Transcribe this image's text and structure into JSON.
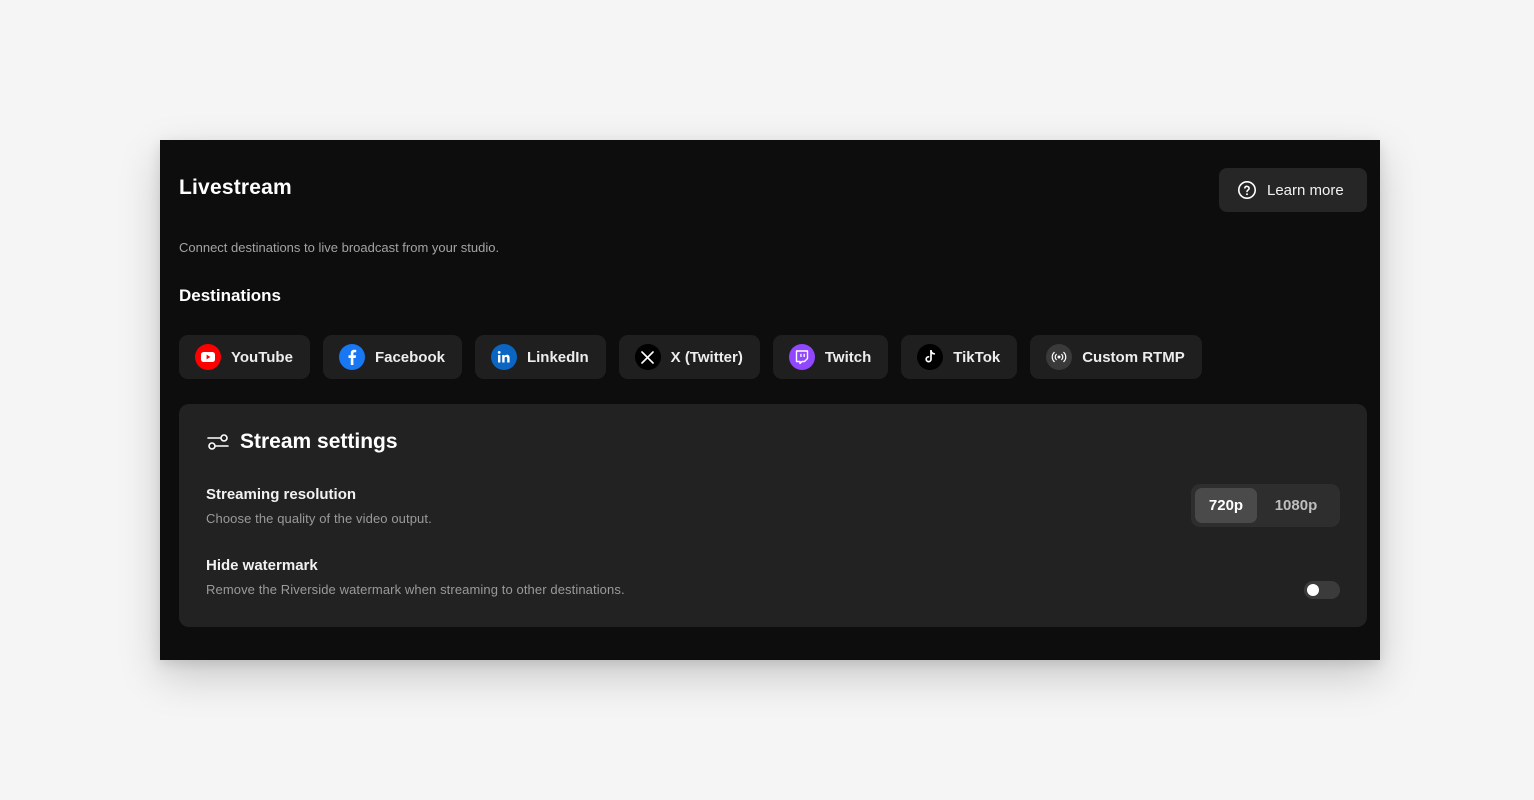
{
  "header": {
    "title": "Livestream",
    "learn_more_label": "Learn more",
    "subtitle": "Connect destinations to live broadcast from your studio."
  },
  "destinations": {
    "title": "Destinations",
    "items": [
      {
        "label": "YouTube",
        "icon": "youtube-icon",
        "color": "#ff0000"
      },
      {
        "label": "Facebook",
        "icon": "facebook-icon",
        "color": "#1877f2"
      },
      {
        "label": "LinkedIn",
        "icon": "linkedin-icon",
        "color": "#0a66c2"
      },
      {
        "label": "X (Twitter)",
        "icon": "x-twitter-icon",
        "color": "#000000"
      },
      {
        "label": "Twitch",
        "icon": "twitch-icon",
        "color": "#9146ff"
      },
      {
        "label": "TikTok",
        "icon": "tiktok-icon",
        "color": "#000000"
      },
      {
        "label": "Custom RTMP",
        "icon": "broadcast-icon",
        "color": "#3a3a3a"
      }
    ]
  },
  "stream_settings": {
    "title": "Stream settings",
    "resolution": {
      "title": "Streaming resolution",
      "description": "Choose the quality of the video output.",
      "options": [
        "720p",
        "1080p"
      ],
      "selected": "720p"
    },
    "watermark": {
      "title": "Hide watermark",
      "description": "Remove the Riverside watermark when streaming to other destinations.",
      "enabled": false
    }
  }
}
